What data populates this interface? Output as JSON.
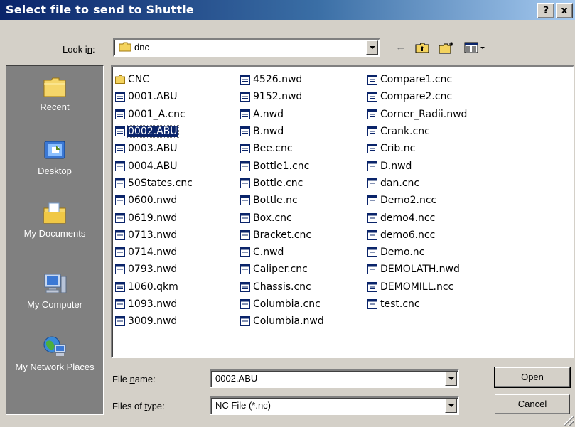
{
  "window": {
    "title": "Select file to send to Shuttle",
    "help_label": "?",
    "close_label": "x"
  },
  "lookin": {
    "label": "Look in:",
    "value": "dnc"
  },
  "places": [
    {
      "label": "Recent",
      "icon": "recent-folder-icon"
    },
    {
      "label": "Desktop",
      "icon": "desktop-icon"
    },
    {
      "label": "My Documents",
      "icon": "my-documents-icon"
    },
    {
      "label": "My Computer",
      "icon": "my-computer-icon"
    },
    {
      "label": "My Network Places",
      "icon": "network-places-icon"
    }
  ],
  "files": {
    "col1": [
      "CNC",
      "0001.ABU",
      "0001_A.cnc",
      "0002.ABU",
      "0003.ABU",
      "0004.ABU",
      "50States.cnc",
      "0600.nwd",
      "0619.nwd",
      "0713.nwd",
      "0714.nwd",
      "0793.nwd",
      "1060.qkm",
      "1093.nwd",
      "3009.nwd"
    ],
    "col2": [
      "4526.nwd",
      "9152.nwd",
      "A.nwd",
      "B.nwd",
      "Bee.cnc",
      "Bottle1.cnc",
      "Bottle.cnc",
      "Bottle.nc",
      "Box.cnc",
      "Bracket.cnc",
      "C.nwd",
      "Caliper.cnc",
      "Chassis.cnc",
      "Columbia.cnc",
      "Columbia.nwd"
    ],
    "col3": [
      "Compare1.cnc",
      "Compare2.cnc",
      "Corner_Radii.nwd",
      "Crank.cnc",
      "Crib.nc",
      "D.nwd",
      "dan.cnc",
      "Demo2.ncc",
      "demo4.ncc",
      "demo6.ncc",
      "Demo.nc",
      "DEMOLATH.nwd",
      "DEMOMILL.ncc",
      "test.cnc"
    ],
    "selected": "0002.ABU",
    "folder_items": [
      "CNC"
    ]
  },
  "filename": {
    "label": "File name:",
    "value": "0002.ABU"
  },
  "filetype": {
    "label": "Files of type:",
    "value": "NC File (*.nc)"
  },
  "buttons": {
    "open": "Open",
    "cancel": "Cancel"
  },
  "colors": {
    "title_start": "#0a246a",
    "title_end": "#a6caf0",
    "face": "#d4d0c8",
    "selection": "#0a246a"
  }
}
